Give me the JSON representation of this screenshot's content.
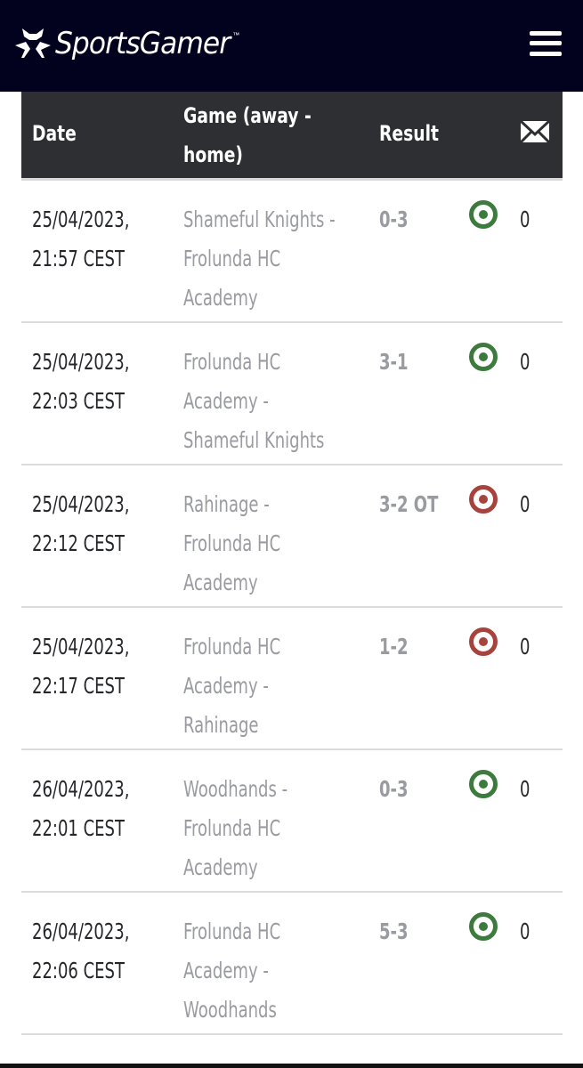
{
  "header": {
    "brand": "SportsGamer",
    "trademark": "™",
    "logo_icon": "sportsgamer-logo-icon",
    "menu_icon": "hamburger-menu-icon",
    "background_color": "#03021e"
  },
  "table": {
    "columns": {
      "date": "Date",
      "game": "Game (away - home)",
      "result": "Result",
      "messages_icon": "envelope-icon"
    },
    "header_color": "#2e2f33",
    "status_colors": {
      "win": "#3d7a3d",
      "loss": "#a8423c"
    },
    "rows": [
      {
        "date": "25/04/2023,",
        "time": "21:57 CEST",
        "game_l1": "Shameful Knights -",
        "game_l2": "Frolunda HC",
        "game_l3": "Academy",
        "result": "0-3",
        "status": "win",
        "count": "0"
      },
      {
        "date": "25/04/2023,",
        "time": "22:03 CEST",
        "game_l1": "Frolunda HC",
        "game_l2": "Academy -",
        "game_l3": "Shameful Knights",
        "result": "3-1",
        "status": "win",
        "count": "0"
      },
      {
        "date": "25/04/2023,",
        "time": "22:12 CEST",
        "game_l1": "Rahinage -",
        "game_l2": "Frolunda HC",
        "game_l3": "Academy",
        "result": "3-2 OT",
        "status": "loss",
        "count": "0"
      },
      {
        "date": "25/04/2023,",
        "time": "22:17 CEST",
        "game_l1": "Frolunda HC",
        "game_l2": "Academy -",
        "game_l3": "Rahinage",
        "result": "1-2",
        "status": "loss",
        "count": "0"
      },
      {
        "date": "26/04/2023,",
        "time": "22:01 CEST",
        "game_l1": "Woodhands -",
        "game_l2": "Frolunda HC",
        "game_l3": "Academy",
        "result": "0-3",
        "status": "win",
        "count": "0"
      },
      {
        "date": "26/04/2023,",
        "time": "22:06 CEST",
        "game_l1": "Frolunda HC",
        "game_l2": "Academy -",
        "game_l3": "Woodhands",
        "result": "5-3",
        "status": "win",
        "count": "0"
      }
    ]
  }
}
